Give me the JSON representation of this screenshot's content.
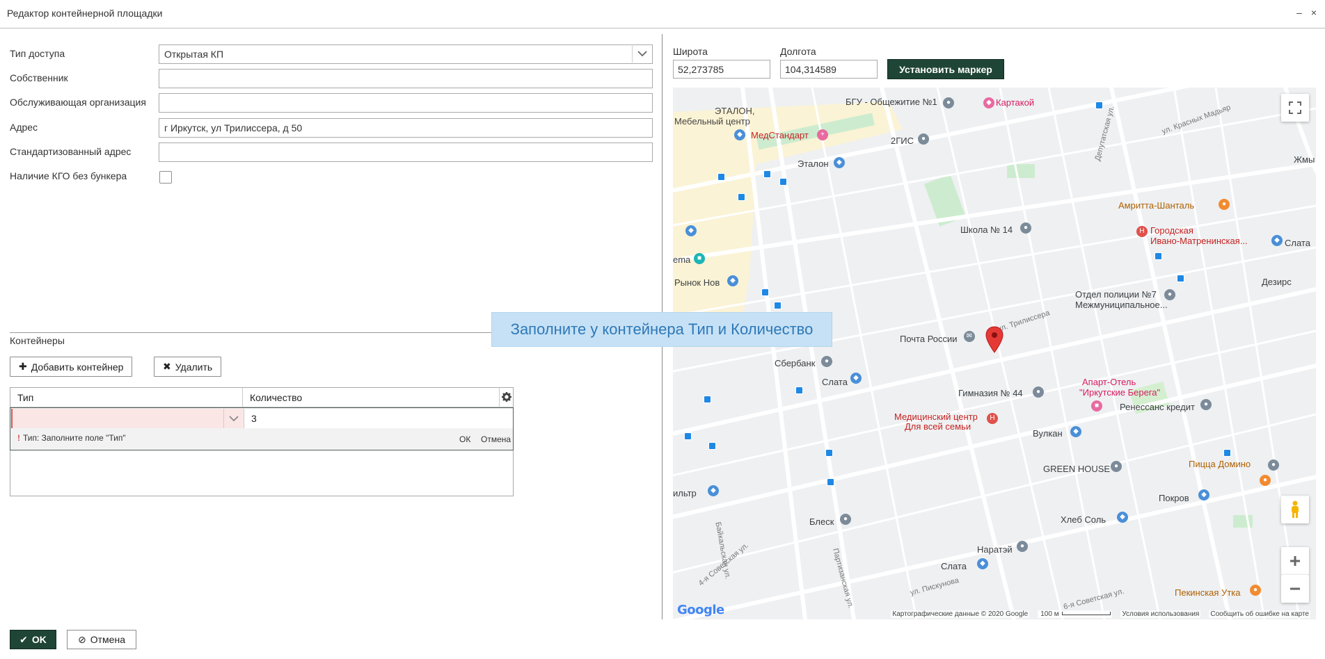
{
  "window": {
    "title": "Редактор контейнерной площадки",
    "minimize_glyph": "–",
    "close_glyph": "×"
  },
  "form": {
    "access_type": {
      "label": "Тип доступа",
      "value": "Открытая КП"
    },
    "owner": {
      "label": "Собственник",
      "value": ""
    },
    "service_org": {
      "label": "Обслуживающая организация",
      "value": ""
    },
    "address": {
      "label": "Адрес",
      "value": "г Иркутск, ул Трилиссера, д 50"
    },
    "std_address": {
      "label": "Стандартизованный адрес",
      "value": ""
    },
    "kgo": {
      "label": "Наличие КГО без бункера",
      "checked": false
    }
  },
  "containers": {
    "section_title": "Контейнеры",
    "add_button": "Добавить контейнер",
    "delete_button": "Удалить",
    "columns": [
      "Тип",
      "Количество"
    ],
    "editing_row": {
      "type": "",
      "quantity": "3"
    },
    "validation": {
      "marker": "!",
      "message": "Тип: Заполните поле \"Тип\"",
      "ok": "ОК",
      "cancel": "Отмена"
    }
  },
  "map": {
    "latitude_label": "Широта",
    "latitude_value": "52,273785",
    "longitude_label": "Долгота",
    "longitude_value": "104,314589",
    "set_marker_button": "Установить маркер",
    "labels": {
      "etalon_furniture": "ЭТАЛОН,",
      "etalon_furniture2": "Мебельный центр",
      "bgu": "БГУ - Общежитие №1",
      "kartakoy": "Картакой",
      "medstandart": "МедСтандарт",
      "gis": "2ГИС",
      "etalon": "Эталон",
      "krasnyh_madyar": "ул. Красных Мадьяр",
      "deputatskaya": "Депутатская ул.",
      "zhmy": "Жмы",
      "amritta": "Амритта-Шанталь",
      "hospital1": "Городская",
      "hospital2": "Ивано-Матренинская...",
      "slata_right": "Слата",
      "school": "Школа № 14",
      "dezires": "Дезирс",
      "cinema": "ema",
      "rynok": "Рынок Нов",
      "police1": "Отдел полиции №7",
      "police2": "Межмуниципальное...",
      "post": "Почта России",
      "trilissera": "ул. Трилиссера",
      "sberbank": "Сбербанк",
      "slata_mid": "Слата",
      "gym1": "Гимназия № 44",
      "apart1": "Апарт-Отель",
      "apart2": "\"Иркутские Берега\"",
      "renaissance": "Ренессанс кредит",
      "med1": "Медицинский центр",
      "med2": "Для всей семьи",
      "vulkan": "Вулкан",
      "green_house": "GREEN HOUSE",
      "pizza": "Пицца Домино",
      "filter": "ильтр",
      "baikal": "Байкальская ул.",
      "pokrov": "Покров",
      "hleb": "Хлеб Соль",
      "blesk": "Блеск",
      "naratei": "Наратэй",
      "slata_bottom": "Слата",
      "peking": "Пекинская Утка",
      "partizanskaya": "Партизанская ул.",
      "piskunova": "ул. Пискунова",
      "sovetskaya4": "4-я Советская ул.",
      "sovetskaya6": "6-я Советская ул."
    },
    "footer": {
      "data": "Картографические данные © 2020 Google",
      "scale": "100 м",
      "terms": "Условия использования",
      "report": "Сообщить об ошибке на карте"
    },
    "google_logo": "Google"
  },
  "toast": "Заполните у контейнера Тип и Количество",
  "footer": {
    "ok": "OK",
    "cancel": "Отмена"
  }
}
